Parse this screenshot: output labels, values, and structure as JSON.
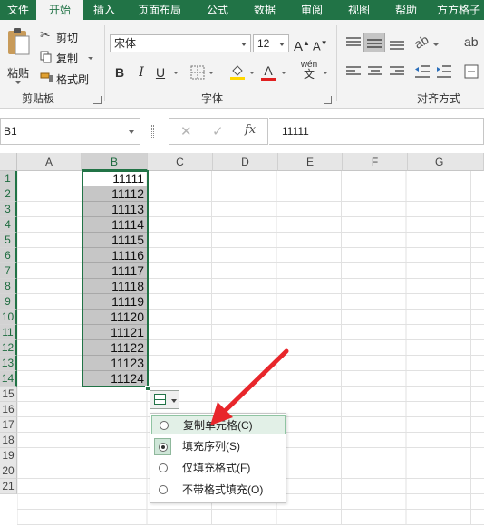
{
  "tabs": [
    "文件",
    "开始",
    "插入",
    "页面布局",
    "公式",
    "数据",
    "审阅",
    "视图",
    "帮助",
    "方方格子"
  ],
  "active_tab": "开始",
  "clipboard": {
    "paste_label": "粘贴",
    "cut_label": "剪切",
    "copy_label": "复制",
    "format_painter_label": "格式刷",
    "group_label": "剪贴板"
  },
  "font": {
    "font_name": "宋体",
    "font_size": "12",
    "increase_size": "A",
    "decrease_size": "A",
    "bold": "B",
    "italic": "I",
    "underline": "U",
    "font_color": "A",
    "phonetic": "wén",
    "group_label": "字体",
    "font_color_hex": "#e02020",
    "fill_color_hex": "#ffd700"
  },
  "alignment": {
    "group_label": "对齐方式"
  },
  "formula_bar": {
    "name_box": "B1",
    "cancel_icon": "✕",
    "enter_icon": "✓",
    "fx_label": "fx",
    "content": "11111"
  },
  "columns": [
    "A",
    "B",
    "C",
    "D",
    "E",
    "F",
    "G"
  ],
  "rows": [
    "1",
    "2",
    "3",
    "4",
    "5",
    "6",
    "7",
    "8",
    "9",
    "10",
    "11",
    "12",
    "13",
    "14",
    "15",
    "16",
    "17",
    "18",
    "19",
    "20",
    "21"
  ],
  "column_b_values": [
    "11111",
    "11112",
    "11113",
    "11114",
    "11115",
    "11116",
    "11117",
    "11118",
    "11119",
    "11120",
    "11121",
    "11122",
    "11123",
    "11124"
  ],
  "autofill_menu": {
    "items": [
      {
        "label": "复制单元格(C)",
        "selected": false,
        "hovered": true
      },
      {
        "label": "填充序列(S)",
        "selected": true,
        "hovered": false
      },
      {
        "label": "仅填充格式(F)",
        "selected": false,
        "hovered": false
      },
      {
        "label": "不带格式填充(O)",
        "selected": false,
        "hovered": false
      }
    ]
  },
  "colors": {
    "accent": "#217346",
    "annotation_arrow": "#e8262b"
  }
}
